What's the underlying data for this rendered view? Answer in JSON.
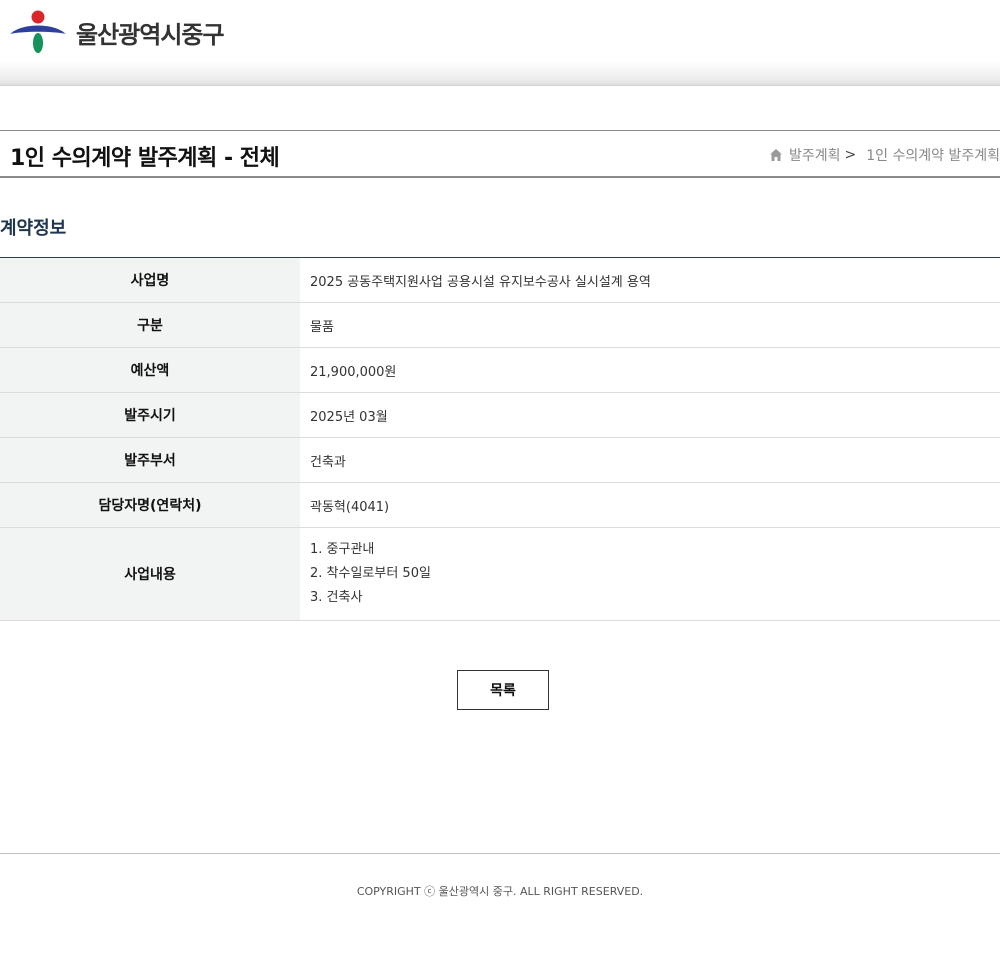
{
  "header": {
    "logo_text": "울산광역시중구"
  },
  "page": {
    "title": "1인 수의계약 발주계획 - 전체"
  },
  "breadcrumb": {
    "items": [
      "발주계획",
      "1인 수의계약 발주계획"
    ],
    "separator": ">"
  },
  "section": {
    "title": "계약정보"
  },
  "contract": {
    "rows": [
      {
        "label": "사업명",
        "value": "2025 공동주택지원사업 공용시설 유지보수공사 실시설계 용역"
      },
      {
        "label": "구분",
        "value": "물품"
      },
      {
        "label": "예산액",
        "value": "21,900,000원"
      },
      {
        "label": "발주시기",
        "value": "2025년 03월"
      },
      {
        "label": "발주부서",
        "value": "건축과"
      },
      {
        "label": "담당자명(연락처)",
        "value": "곽동혁(4041)"
      }
    ],
    "content": {
      "label": "사업내용",
      "lines": [
        "1. 중구관내",
        "2. 착수일로부터 50일",
        "3. 건축사"
      ]
    }
  },
  "actions": {
    "list_label": "목록"
  },
  "footer": {
    "copyright": "COPYRIGHT ⓒ 울산광역시 중구. ALL RIGHT RESERVED."
  },
  "colors": {
    "logo_red": "#d9262b",
    "logo_blue": "#2c3f9e",
    "logo_green": "#16935a",
    "section_title": "#1f3550",
    "table_header_bg": "#f2f4f3"
  }
}
